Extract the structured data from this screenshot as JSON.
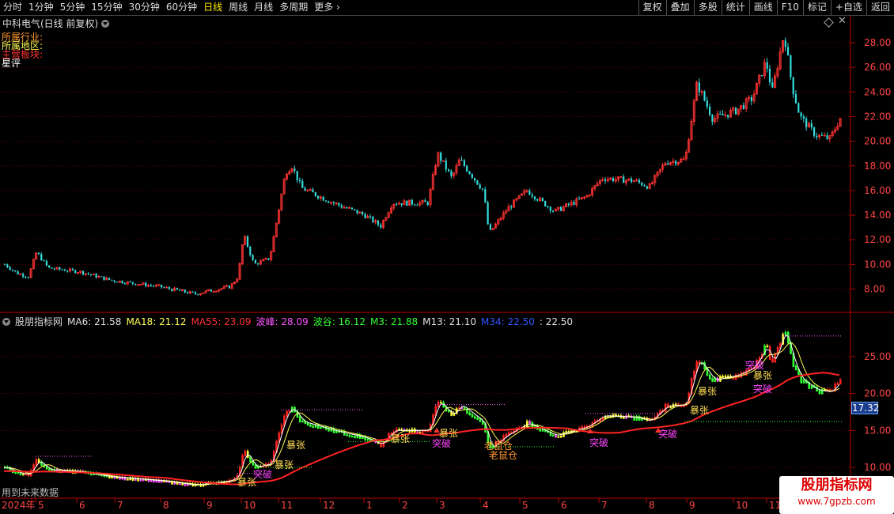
{
  "toolbar": {
    "periods": [
      "分时",
      "1分钟",
      "5分钟",
      "15分钟",
      "30分钟",
      "60分钟",
      "日线",
      "周线",
      "月线",
      "多周期",
      "更多"
    ],
    "active_period": "日线",
    "buttons": [
      "复权",
      "叠加",
      "多股",
      "统计",
      "画线",
      "F10",
      "标记",
      "+自选",
      "返回"
    ]
  },
  "stock": {
    "title": "中科电气(日线 前复权)"
  },
  "info": {
    "line1": "所属行业:",
    "line2": "所属地区:",
    "line3": "主营板块:",
    "line4": "星评"
  },
  "main_axis": {
    "labels": [
      "28.00",
      "26.00",
      "24.00",
      "22.00",
      "20.00",
      "18.00",
      "16.00",
      "14.00",
      "12.00",
      "10.00",
      "8.00"
    ]
  },
  "indicator": {
    "name": "股朋指标网",
    "items": [
      {
        "label": "MA6: 21.58",
        "color": "#e0e0e0"
      },
      {
        "label": "MA18: 21.12",
        "color": "#ffff55"
      },
      {
        "label": "MA55: 23.09",
        "color": "#ff3333"
      },
      {
        "label": "波峰: 28.09",
        "color": "#ff55ff"
      },
      {
        "label": "波谷: 16.12",
        "color": "#33ff33"
      },
      {
        "label": "M3: 21.88",
        "color": "#33ff33"
      },
      {
        "label": "M13: 21.10",
        "color": "#e0e0e0"
      },
      {
        "label": "M34: 22.50",
        "color": "#3355ff"
      },
      {
        "label": ": 22.50",
        "color": "#e0e0e0"
      }
    ],
    "axis_labels": [
      "25.00",
      "20.00",
      "15.00",
      "10.00"
    ],
    "price_tag": "17.32",
    "annotations": [
      {
        "text": "暴张",
        "color": "#ffdd55"
      },
      {
        "text": "突破",
        "color": "#ff44ff"
      },
      {
        "text": "老鼠仓",
        "color": "#ff9933"
      }
    ]
  },
  "date_axis": {
    "labels": [
      "2024年",
      "5",
      "6",
      "7",
      "8",
      "9",
      "10",
      "11",
      "12",
      "1",
      "2",
      "3",
      "4",
      "5",
      "6",
      "7",
      "8",
      "9",
      "10",
      "11"
    ]
  },
  "future_label": "用到未来数据",
  "watermark": {
    "line1": "股朋指标网",
    "line2": "www.7gpzb.com"
  }
}
